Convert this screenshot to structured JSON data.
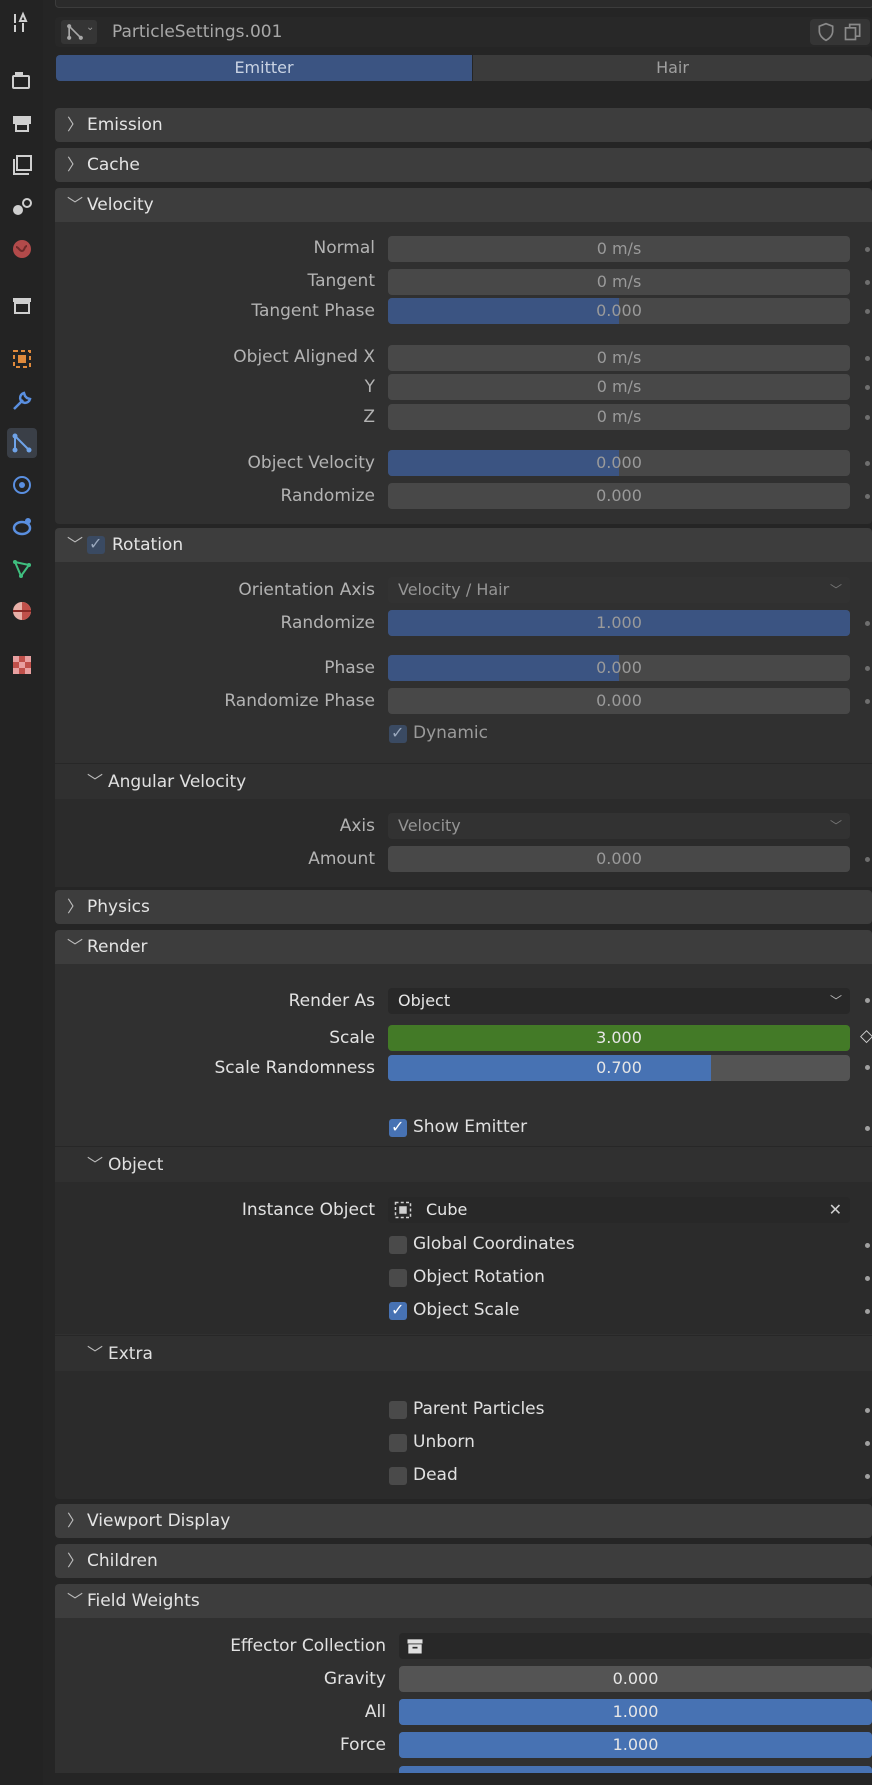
{
  "datablock": {
    "name": "ParticleSettings.001"
  },
  "tabs": [
    {
      "label": "Emitter",
      "active": true
    },
    {
      "label": "Hair",
      "active": false
    }
  ],
  "sidebar_icons": [
    "tool-icon",
    "render-icon",
    "output-icon",
    "view-layer-icon",
    "scene-icon",
    "world-icon",
    "collection-icon",
    "object-icon",
    "modifier-icon",
    "particles-icon",
    "physics-icon",
    "constraints-icon",
    "data-icon",
    "material-icon",
    "texture-icon"
  ],
  "panels": {
    "emission": "Emission",
    "cache": "Cache",
    "velocity": {
      "title": "Velocity",
      "normal": {
        "label": "Normal",
        "value": "0 m/s"
      },
      "tangent": {
        "label": "Tangent",
        "value": "0 m/s"
      },
      "tangent_phase": {
        "label": "Tangent Phase",
        "value": "0.000",
        "fill": 0.5
      },
      "aligned_x": {
        "label": "Object Aligned X",
        "value": "0 m/s"
      },
      "aligned_y": {
        "label": "Y",
        "value": "0 m/s"
      },
      "aligned_z": {
        "label": "Z",
        "value": "0 m/s"
      },
      "object_velocity": {
        "label": "Object Velocity",
        "value": "0.000",
        "fill": 0.5
      },
      "randomize": {
        "label": "Randomize",
        "value": "0.000"
      }
    },
    "rotation": {
      "title": "Rotation",
      "orientation_axis": {
        "label": "Orientation Axis",
        "value": "Velocity / Hair"
      },
      "randomize": {
        "label": "Randomize",
        "value": "1.000",
        "fill": 1.0
      },
      "phase": {
        "label": "Phase",
        "value": "0.000",
        "fill": 0.5
      },
      "randomize_phase": {
        "label": "Randomize Phase",
        "value": "0.000"
      },
      "dynamic": {
        "label": "Dynamic",
        "checked": true
      },
      "angular_velocity": {
        "title": "Angular Velocity",
        "axis": {
          "label": "Axis",
          "value": "Velocity"
        },
        "amount": {
          "label": "Amount",
          "value": "0.000"
        }
      }
    },
    "physics": "Physics",
    "render": {
      "title": "Render",
      "render_as": {
        "label": "Render As",
        "value": "Object"
      },
      "scale": {
        "label": "Scale",
        "value": "3.000",
        "color": "#437a27"
      },
      "scale_randomness": {
        "label": "Scale Randomness",
        "value": "0.700",
        "fill": 0.7
      },
      "show_emitter": {
        "label": "Show Emitter",
        "checked": true
      },
      "object": {
        "title": "Object",
        "instance_object": {
          "label": "Instance Object",
          "value": "Cube"
        },
        "global_coordinates": {
          "label": "Global Coordinates",
          "checked": false
        },
        "object_rotation": {
          "label": "Object Rotation",
          "checked": false
        },
        "object_scale": {
          "label": "Object Scale",
          "checked": true
        }
      },
      "extra": {
        "title": "Extra",
        "parent_particles": {
          "label": "Parent Particles",
          "checked": false
        },
        "unborn": {
          "label": "Unborn",
          "checked": false
        },
        "dead": {
          "label": "Dead",
          "checked": false
        }
      }
    },
    "viewport_display": "Viewport Display",
    "children": "Children",
    "field_weights": {
      "title": "Field Weights",
      "effector_collection": {
        "label": "Effector Collection"
      },
      "gravity": {
        "label": "Gravity",
        "value": "0.000",
        "fill": 0.0
      },
      "all": {
        "label": "All",
        "value": "1.000",
        "fill": 1.0
      },
      "force": {
        "label": "Force",
        "value": "1.000",
        "fill": 1.0
      }
    }
  },
  "colors": {
    "accent": "#4772b3",
    "accent_dim": "#3b5482",
    "keyframe": "#437a27"
  }
}
